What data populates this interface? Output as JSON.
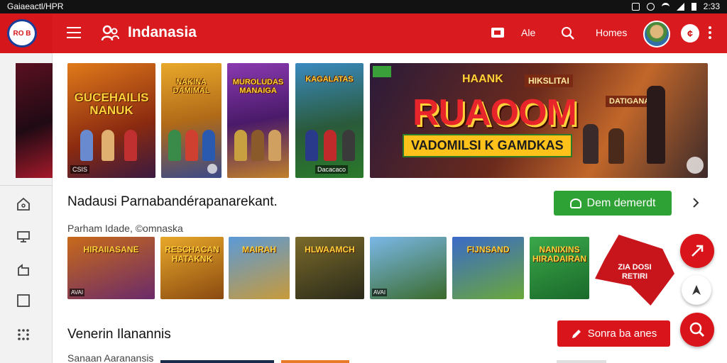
{
  "status_bar": {
    "left_text": "Gaiaeactl/HPR",
    "time": "2:33"
  },
  "header": {
    "app_logo_text": "RO B",
    "title": "Indanasia",
    "lang_label": "Ale",
    "homes_label": "Homes",
    "avatar_menu_glyph": "¢"
  },
  "banners": [
    {
      "title": "GUCEHAILIS NANUK",
      "badge": "CSIS",
      "bg": "#c25a12"
    },
    {
      "title": "NAKINA DAMIMAL",
      "badge": "",
      "bg": "#c98a1a"
    },
    {
      "title": "MUROLUDAS MANAIGA",
      "badge": "",
      "bg": "#5a2a7a"
    },
    {
      "title": "KAGALATAS",
      "badge": "Dacacaco",
      "bg": "#2f6a3a"
    }
  ],
  "hero": {
    "brand": "HAANK",
    "title": "RUAOOM",
    "subtitle": "VADOMILSI K GAMDKAS",
    "tag1": "HIKSLITAI",
    "tag2": "DATIGANALA"
  },
  "section1": {
    "title": "Nadausi Parnabandérapanarekant.",
    "subtitle": "Parham Idade, ©omnaska",
    "button": "Dem demerdt"
  },
  "thumbs": [
    {
      "title": "HIRAIIASANE",
      "badge": "AVAI",
      "bg": "#8a3a12"
    },
    {
      "title": "RESCHACAN HATAKNK",
      "badge": "",
      "bg": "#b8741a"
    },
    {
      "title": "MAIRAH",
      "badge": "",
      "bg": "#4a7ab8"
    },
    {
      "title": "HLWAAMCH",
      "badge": "",
      "bg": "#5a4a1a"
    },
    {
      "title": "",
      "badge": "AVAI",
      "bg": "#4a8ac8"
    },
    {
      "title": "FIJNSAND",
      "badge": "",
      "bg": "#6a9a3a"
    },
    {
      "title": "NANIXINS HIRADAIRAN",
      "badge": "",
      "bg": "#3a8a3a"
    }
  ],
  "promo": {
    "line1": "ZIA DOSI",
    "line2": "RETIRI"
  },
  "section2": {
    "title": "Venerin Ilanannis",
    "subtitle": "Sanaan Aaranansis",
    "button": "Sonra ba anes"
  },
  "colors": {
    "brand_red": "#d91a1f",
    "action_green": "#2ea234"
  }
}
